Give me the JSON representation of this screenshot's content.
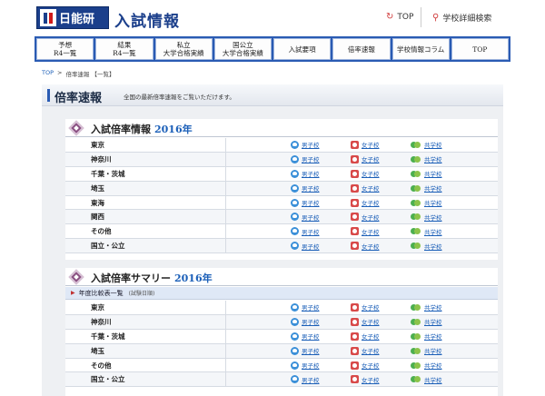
{
  "header": {
    "logo_text": "日能研",
    "site_title": "入試情報",
    "top_link": "TOP",
    "search_link": "学校詳細検索"
  },
  "nav": [
    {
      "line1": "予想",
      "line2": "R4一覧"
    },
    {
      "line1": "結果",
      "line2": "R4一覧"
    },
    {
      "line1": "私立",
      "line2": "大学合格実績"
    },
    {
      "line1": "国公立",
      "line2": "大学合格実績"
    },
    {
      "line1": "入試要項",
      "line2": ""
    },
    {
      "line1": "倍率速報",
      "line2": ""
    },
    {
      "line1": "学校情報コラム",
      "line2": ""
    },
    {
      "line1": "TOP",
      "line2": ""
    }
  ],
  "breadcrumb": {
    "top": "TOP",
    "sep": ">",
    "current": "倍率速報 【一覧】"
  },
  "page": {
    "title": "倍率速報",
    "description": "全国の最新倍率速報をご覧いただけます。"
  },
  "sections": [
    {
      "title": "入試倍率情報",
      "year": "2016年",
      "rows": [
        "東京",
        "神奈川",
        "千葉・茨城",
        "埼玉",
        "東海",
        "関西",
        "その他",
        "国立・公立"
      ]
    },
    {
      "title": "入試倍率サマリー",
      "year": "2016年",
      "subhead": "年度比較表一覧",
      "subhead_note": "(試験日順)",
      "rows": [
        "東京",
        "神奈川",
        "千葉・茨城",
        "埼玉",
        "その他",
        "国立・公立"
      ]
    }
  ],
  "links": {
    "boys": "男子校",
    "girls": "女子校",
    "coed": "共学校"
  },
  "colors": {
    "brand_blue": "#1b3f8b",
    "nav_blue": "#2a5bb3",
    "link": "#1b5fb8",
    "accent_red": "#d01a1a"
  }
}
